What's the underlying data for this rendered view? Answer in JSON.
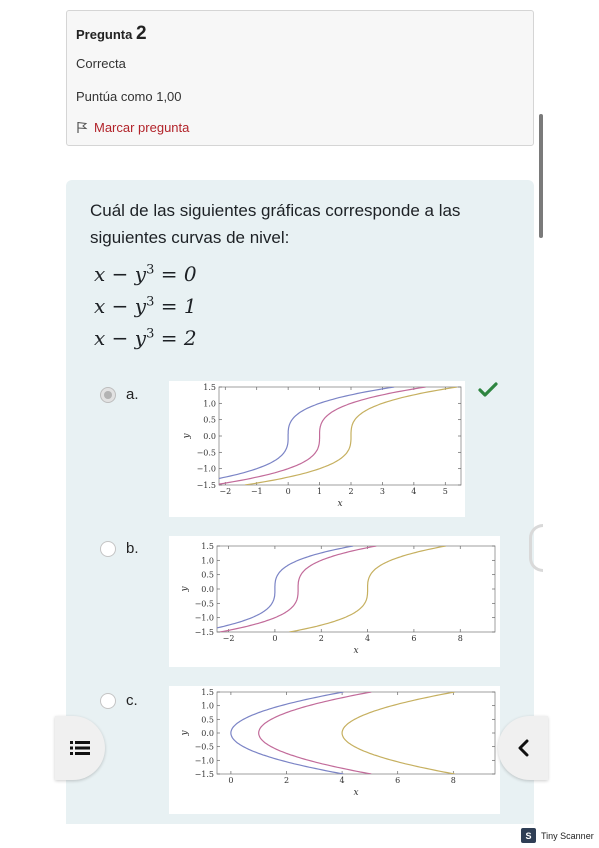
{
  "question": {
    "title_prefix": "Pregunta",
    "number": "2",
    "state": "Correcta",
    "grade": "Puntúa como 1,00",
    "flag_label": "Marcar pregunta",
    "text": "Cuál de las siguientes gráficas corresponde a las siguientes curvas de nivel:",
    "equations": [
      {
        "lhs": "x − y",
        "exp": "3",
        "rhs": " = 0"
      },
      {
        "lhs": "x − y",
        "exp": "3",
        "rhs": " = 1"
      },
      {
        "lhs": "x − y",
        "exp": "3",
        "rhs": " = 2"
      }
    ]
  },
  "options": [
    {
      "label": "a.",
      "selected": true,
      "correct": true
    },
    {
      "label": "b.",
      "selected": false
    },
    {
      "label": "c.",
      "selected": false
    }
  ],
  "colors": {
    "accent_flag": "#b2232a",
    "panel": "#e8f1f3",
    "correct_check": "#2e8540",
    "curve1": "#7b84c6",
    "curve2": "#c26b9a",
    "curve3": "#c6b060"
  },
  "icons": {
    "flag": "flag-icon",
    "check": "check-icon",
    "menu": "menu-icon",
    "back": "chevron-left-icon"
  },
  "brand": {
    "label": "Tiny Scanner"
  },
  "chart_data": [
    {
      "type": "line",
      "xlabel": "x",
      "ylabel": "y",
      "xlim": [
        -2.2,
        5.5
      ],
      "ylim": [
        -1.5,
        1.5
      ],
      "xticks": [
        "−2",
        "−1",
        "0",
        "1",
        "2",
        "3",
        "4",
        "5"
      ],
      "yticks": [
        "1.5",
        "1.0",
        "0.5",
        "0.0",
        "−0.5",
        "−1.0",
        "−1.5"
      ],
      "series": [
        {
          "description": "x − y^3 = 0",
          "x": [
            -2.2,
            2.3
          ]
        },
        {
          "description": "x − y^3 = 1",
          "x": [
            -1.2,
            3.3
          ]
        },
        {
          "description": "x − y^3 = 2",
          "x": [
            -0.2,
            4.3
          ]
        }
      ]
    },
    {
      "type": "line",
      "xlabel": "x",
      "ylabel": "y",
      "xlim": [
        -2.5,
        9.5
      ],
      "ylim": [
        -1.5,
        1.5
      ],
      "xticks": [
        "−2",
        "0",
        "2",
        "4",
        "6",
        "8"
      ],
      "yticks": [
        "1.5",
        "1.0",
        "0.5",
        "0.0",
        "−0.5",
        "−1.0",
        "−1.5"
      ],
      "series": [
        {
          "description": "x − y^3 = 0"
        },
        {
          "description": "x − y^3 = 1"
        },
        {
          "description": "x − y^3 = 8"
        }
      ]
    },
    {
      "type": "line",
      "xlabel": "x",
      "ylabel": "y",
      "xlim": [
        -0.5,
        9.5
      ],
      "ylim": [
        -1.5,
        1.5
      ],
      "xticks": [
        "0",
        "2",
        "4",
        "6",
        "8"
      ],
      "yticks": [
        "1.5",
        "1.0",
        "0.5",
        "0.0",
        "−0.5",
        "−1.0",
        "−1.5"
      ],
      "series": [
        {
          "description": "x = y^2 + c"
        },
        {
          "description": "x = y^2 + c"
        },
        {
          "description": "x = y^2 + c"
        }
      ]
    }
  ]
}
